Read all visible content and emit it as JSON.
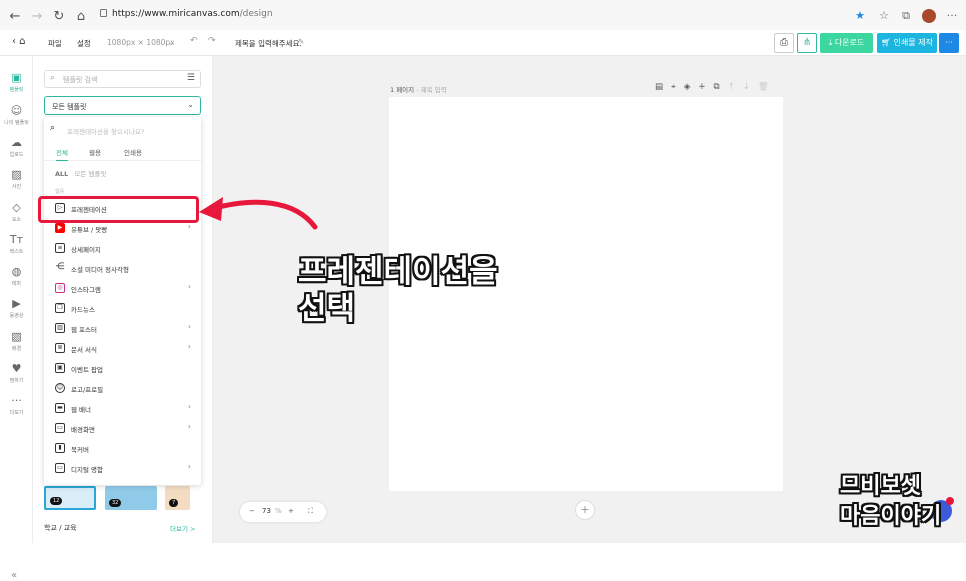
{
  "browser": {
    "url_host": "https://www.miricanvas.com",
    "url_path": "/design",
    "nav_icons": [
      "back-icon",
      "forward-icon",
      "reload-icon",
      "home-icon"
    ]
  },
  "toolbar": {
    "menu_file": "파일",
    "menu_settings": "설정",
    "size": "1080px × 1080px",
    "title_placeholder": "제목을 입력해주세요.",
    "download": "다운로드",
    "print": "인쇄물 제작",
    "more": "···"
  },
  "rail": {
    "items": [
      {
        "label": "템플릿",
        "icon": "template-icon"
      },
      {
        "label": "나의 템플릿",
        "icon": "my-template-icon"
      },
      {
        "label": "업로드",
        "icon": "upload-icon"
      },
      {
        "label": "사진",
        "icon": "photo-icon"
      },
      {
        "label": "요소",
        "icon": "elements-icon"
      },
      {
        "label": "텍스트",
        "icon": "text-icon"
      },
      {
        "label": "테마",
        "icon": "theme-icon"
      },
      {
        "label": "동영상",
        "icon": "video-icon"
      },
      {
        "label": "배경",
        "icon": "background-icon"
      },
      {
        "label": "찜하기",
        "icon": "heart-icon"
      },
      {
        "label": "더보기",
        "icon": "more-icon"
      }
    ]
  },
  "panel": {
    "search_placeholder": "템플릿 검색",
    "select_value": "모든 템플릿",
    "footer_category": "학교 / 교육",
    "footer_more": "더보기 >",
    "thumb_counts": [
      "12",
      "32",
      "7"
    ]
  },
  "dropdown": {
    "search_placeholder": "프레젠테이션을 찾으시나요?",
    "tabs": [
      "전체",
      "웹용",
      "인쇄용"
    ],
    "all_tag": "ALL",
    "all_label": "모든 템플릿",
    "section_label": "웹용",
    "items": [
      {
        "label": "프레젠테이션",
        "arrow": false
      },
      {
        "label": "유튜브 / 팟빵",
        "arrow": true
      },
      {
        "label": "상세페이지",
        "arrow": false
      },
      {
        "label": "소셜 미디어 정사각형",
        "arrow": false
      },
      {
        "label": "인스타그램",
        "arrow": true
      },
      {
        "label": "카드뉴스",
        "arrow": false
      },
      {
        "label": "웹 포스터",
        "arrow": true
      },
      {
        "label": "문서 서식",
        "arrow": true
      },
      {
        "label": "이벤트 팝업",
        "arrow": false
      },
      {
        "label": "로고/프로필",
        "arrow": false
      },
      {
        "label": "웹 배너",
        "arrow": true
      },
      {
        "label": "배경화면",
        "arrow": true
      },
      {
        "label": "북커버",
        "arrow": false
      },
      {
        "label": "디지털 명함",
        "arrow": true
      }
    ]
  },
  "canvas": {
    "page_label": "1 페이지",
    "page_title_placeholder": "- 제목 입력",
    "zoom": "73",
    "zoom_unit": "%"
  },
  "annotation": {
    "line1": "프레젠테이션을",
    "line2": "선택"
  },
  "watermark": {
    "line1": "므비보셋",
    "line2": "마음이야기"
  },
  "colors": {
    "accent": "#2fb8a0",
    "download_btn": "#3cd6a0",
    "print_btn": "#1cb5e0",
    "more_btn": "#1e88e5",
    "highlight": "#e8183c"
  }
}
